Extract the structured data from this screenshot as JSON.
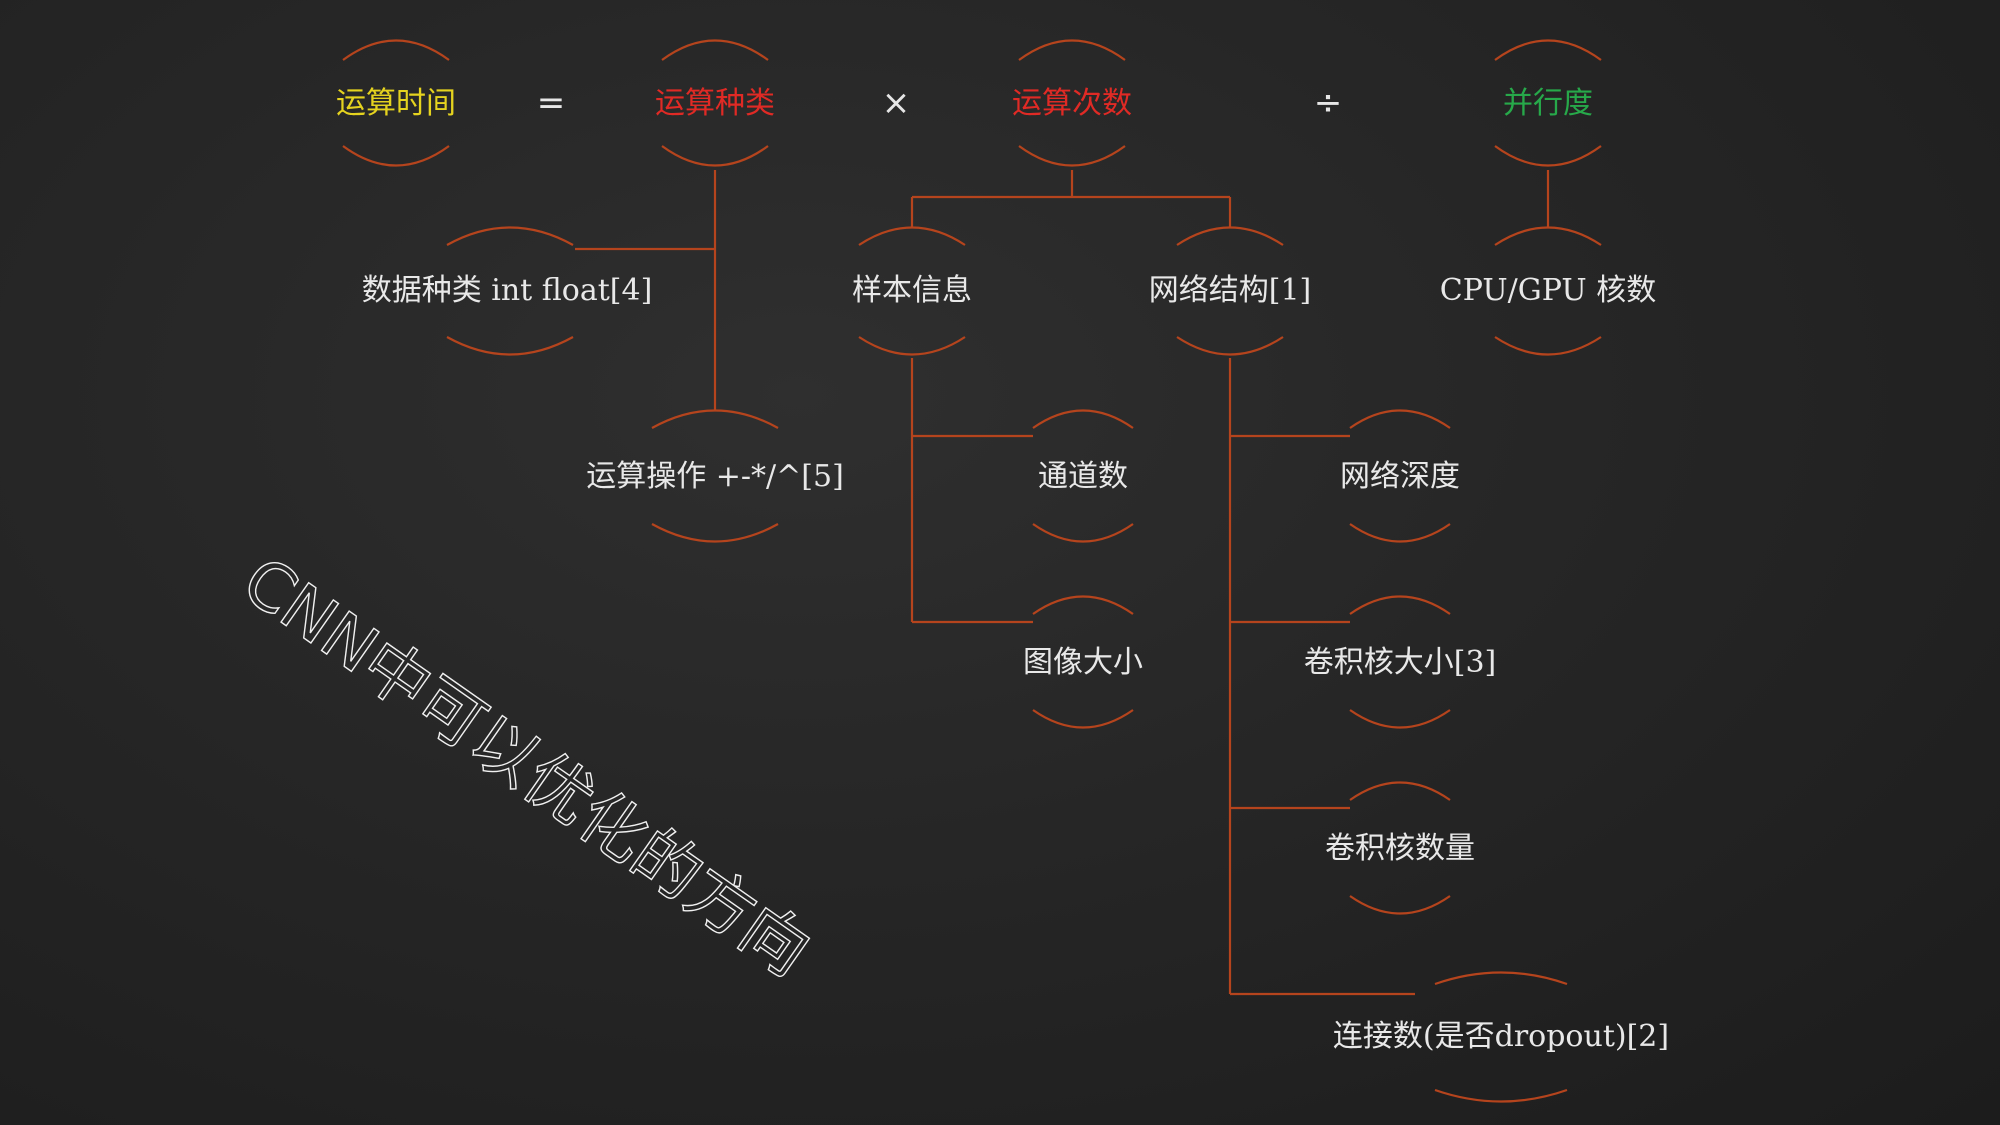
{
  "colors": {
    "connector": "#b5441d",
    "default_text": "#e8e8e8",
    "time": "#e5d31f",
    "red": "#e02a25",
    "green": "#27a94a",
    "watermark": "#f0f0f0"
  },
  "formula": {
    "time": "运算时间",
    "eq": "=",
    "kinds": "运算种类",
    "times": "×",
    "count": "运算次数",
    "div": "÷",
    "parallel": "并行度"
  },
  "kinds_children": {
    "dtype": "数据种类 int float[4]",
    "ops": "运算操作 +-*/^[5]"
  },
  "count_children": {
    "sample": "样本信息",
    "network": "网络结构[1]"
  },
  "sample_children": {
    "channels": "通道数",
    "image_size": "图像大小"
  },
  "network_children": {
    "depth": "网络深度",
    "kernel_size": "卷积核大小[3]",
    "kernel_count": "卷积核数量",
    "connections": "连接数(是否dropout)[2]"
  },
  "parallel_children": {
    "cores": "CPU/GPU 核数"
  },
  "watermark": "CNN中可以优化的方向"
}
